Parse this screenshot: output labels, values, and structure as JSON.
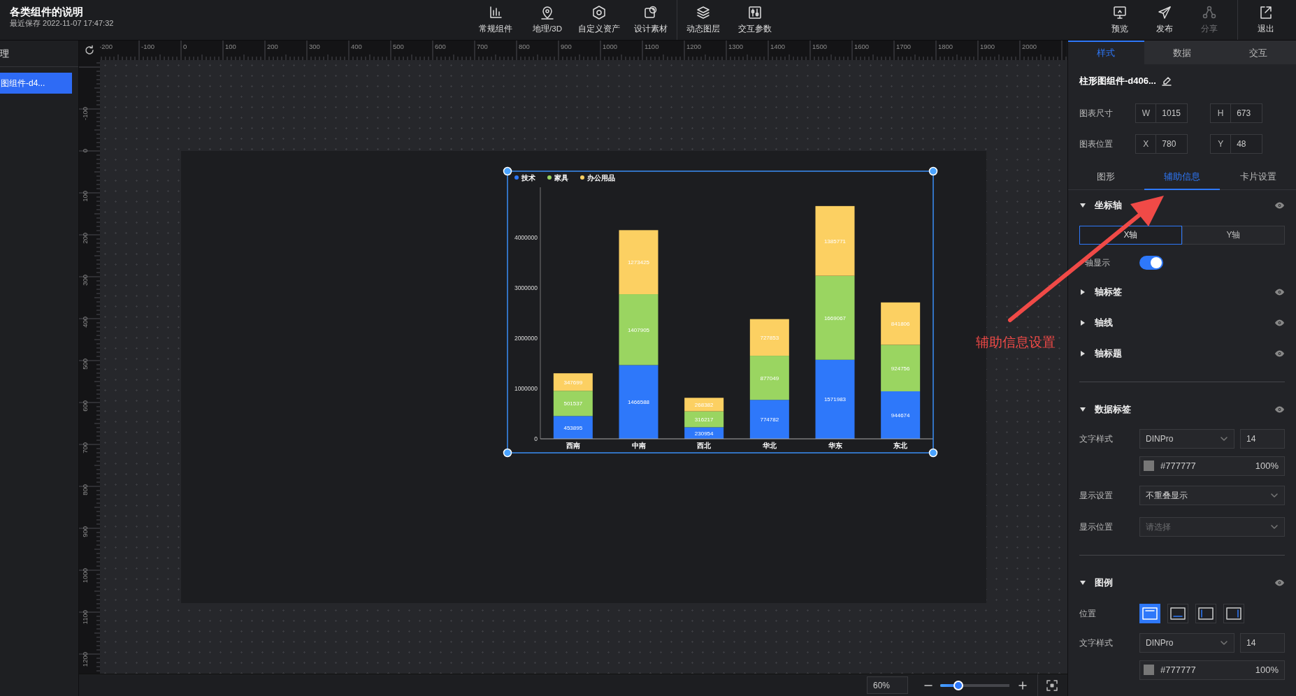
{
  "header": {
    "title": "各类组件的说明",
    "subtitle": "最近保存 2022-11-07 17:47:32"
  },
  "toolbar": [
    {
      "label": "常规组件"
    },
    {
      "label": "地理/3D"
    },
    {
      "label": "自定义资产"
    },
    {
      "label": "设计素材"
    },
    {
      "label": "动态图层"
    },
    {
      "label": "交互参数"
    }
  ],
  "actions": [
    {
      "label": "预览",
      "disabled": false
    },
    {
      "label": "发布",
      "disabled": false
    },
    {
      "label": "分享",
      "disabled": true
    },
    {
      "label": "退出",
      "disabled": false
    }
  ],
  "layers": {
    "title": "理",
    "items": [
      {
        "label": "图组件-d4...",
        "selected": true
      }
    ]
  },
  "rulers": {
    "x_labels": [
      "-200",
      "-100",
      "0",
      "100",
      "200",
      "300",
      "400",
      "500",
      "600",
      "700",
      "800",
      "900",
      "1000",
      "1100",
      "1200",
      "1300",
      "1400",
      "1500",
      "1600",
      "1700",
      "1800",
      "1900",
      "2000"
    ],
    "y_labels": [
      "-100",
      "0",
      "100",
      "200",
      "300",
      "400",
      "500",
      "600",
      "700",
      "800",
      "900",
      "1000",
      "1100",
      "1200"
    ]
  },
  "chart": {
    "chart_data": {
      "type": "bar",
      "stacked": true,
      "categories": [
        "西南",
        "中南",
        "西北",
        "华北",
        "华东",
        "东北"
      ],
      "series": [
        {
          "name": "技术",
          "color": "#2e78fa",
          "values": [
            453895,
            1466588,
            230954,
            774782,
            1571983,
            944674
          ]
        },
        {
          "name": "家具",
          "color": "#9ad561",
          "values": [
            501537,
            1407905,
            316217,
            877049,
            1669067,
            924756
          ]
        },
        {
          "name": "办公用品",
          "color": "#fcd062",
          "values": [
            347699,
            1273425,
            268382,
            727853,
            1385771,
            841806
          ]
        }
      ],
      "legend": true,
      "ylim": [
        0,
        5000000
      ],
      "yticks": [
        0,
        1000000,
        2000000,
        3000000,
        4000000
      ],
      "data_labels": true
    }
  },
  "annotation": {
    "text": "辅助信息设置"
  },
  "zoom": {
    "value": "60%",
    "level": 0.26
  },
  "panel": {
    "tabs": [
      {
        "label": "样式",
        "selected": true
      },
      {
        "label": "数据",
        "selected": false
      },
      {
        "label": "交互",
        "selected": false
      }
    ],
    "component_name": "柱形图组件-d406...",
    "metrics": [
      {
        "label": "图表尺寸",
        "fields": [
          {
            "prefix": "W",
            "value": "1015"
          },
          {
            "prefix": "H",
            "value": "673"
          }
        ]
      },
      {
        "label": "图表位置",
        "fields": [
          {
            "prefix": "X",
            "value": "780"
          },
          {
            "prefix": "Y",
            "value": "48"
          }
        ]
      }
    ],
    "subtabs": [
      {
        "label": "图形",
        "selected": false
      },
      {
        "label": "辅助信息",
        "selected": true
      },
      {
        "label": "卡片设置",
        "selected": false
      }
    ],
    "rows": [
      {
        "kind": "header",
        "title": "坐标轴",
        "expanded": true
      },
      {
        "kind": "segmented",
        "options": [
          {
            "label": "X轴",
            "selected": true
          },
          {
            "label": "Y轴",
            "selected": false
          }
        ]
      },
      {
        "kind": "toggle",
        "label": "轴显示",
        "on": true
      },
      {
        "kind": "header",
        "title": "轴标签",
        "expanded": false
      },
      {
        "kind": "header",
        "title": "轴线",
        "expanded": false
      },
      {
        "kind": "header",
        "title": "轴标题",
        "expanded": false
      },
      {
        "kind": "divider"
      },
      {
        "kind": "header",
        "title": "数据标签",
        "expanded": true
      },
      {
        "kind": "font",
        "label": "文字样式",
        "font": "DINPro",
        "size": "14"
      },
      {
        "kind": "color",
        "color": "#777777",
        "value": "#777777",
        "opacity": "100%"
      },
      {
        "kind": "select",
        "label": "显示设置",
        "value": "不重叠显示"
      },
      {
        "kind": "select",
        "label": "显示位置",
        "placeholder": "请选择"
      },
      {
        "kind": "divider"
      },
      {
        "kind": "header",
        "title": "图例",
        "expanded": true
      },
      {
        "kind": "positions",
        "label": "位置",
        "options": [
          {
            "selected": true
          },
          {
            "selected": false
          },
          {
            "selected": false
          },
          {
            "selected": false
          }
        ]
      },
      {
        "kind": "font",
        "label": "文字样式",
        "font": "DINPro",
        "size": "14"
      },
      {
        "kind": "color",
        "color": "#777777",
        "value": "#777777",
        "opacity": "100%"
      }
    ]
  }
}
